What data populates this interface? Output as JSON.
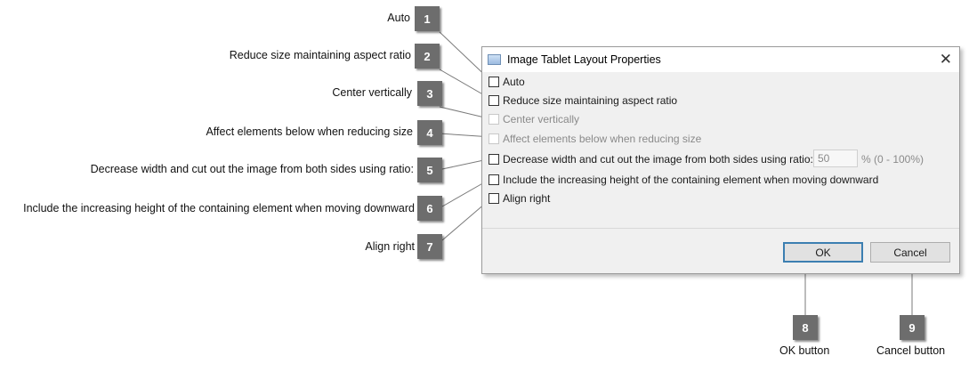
{
  "callouts": [
    {
      "num": "1",
      "label": "Auto"
    },
    {
      "num": "2",
      "label": "Reduce size maintaining aspect ratio"
    },
    {
      "num": "3",
      "label": "Center vertically"
    },
    {
      "num": "4",
      "label": "Affect elements below when reducing size"
    },
    {
      "num": "5",
      "label": "Decrease width and cut out the image from both sides using ratio:"
    },
    {
      "num": "6",
      "label": "Include the increasing height of the containing element when moving downward"
    },
    {
      "num": "7",
      "label": "Align right"
    },
    {
      "num": "8",
      "label": "OK button"
    },
    {
      "num": "9",
      "label": "Cancel button"
    }
  ],
  "dialog": {
    "title": "Image Tablet Layout Properties",
    "close_glyph": "✕",
    "options": [
      {
        "label": "Auto",
        "checked": false,
        "enabled": true
      },
      {
        "label": "Reduce size maintaining aspect ratio",
        "checked": false,
        "enabled": true
      },
      {
        "label": "Center vertically",
        "checked": false,
        "enabled": false
      },
      {
        "label": "Affect elements below when reducing size",
        "checked": false,
        "enabled": false
      },
      {
        "label": "Decrease width and cut out the image from both sides using ratio:",
        "checked": false,
        "enabled": true
      },
      {
        "label": "Include the increasing height of the containing element when moving downward",
        "checked": false,
        "enabled": true
      },
      {
        "label": "Align right",
        "checked": false,
        "enabled": true
      }
    ],
    "ratio_value": "50",
    "ratio_unit": "% (0 - 100%)",
    "ok_label": "OK",
    "cancel_label": "Cancel"
  }
}
